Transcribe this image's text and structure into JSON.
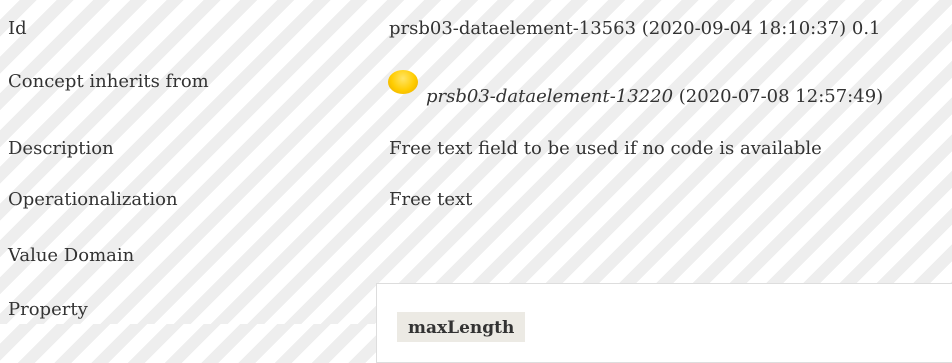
{
  "rows": {
    "id": {
      "label": "Id",
      "value": "prsb03-dataelement-13563 (2020-09-04 18:10:37) 0.1"
    },
    "concept_inherits_from": {
      "label": "Concept inherits from",
      "status_icon": "status-dot-yellow",
      "status_color": "#ffcc00",
      "link": "prsb03-dataelement-13220",
      "date": "(2020-07-08 12:57:49)"
    },
    "description": {
      "label": "Description",
      "value": "Free text field to be used if no code is available"
    },
    "operationalization": {
      "label": "Operationalization",
      "value": "Free text"
    },
    "value_domain": {
      "label": "Value Domain"
    },
    "property": {
      "label": "Property",
      "header": "maxLength"
    }
  }
}
